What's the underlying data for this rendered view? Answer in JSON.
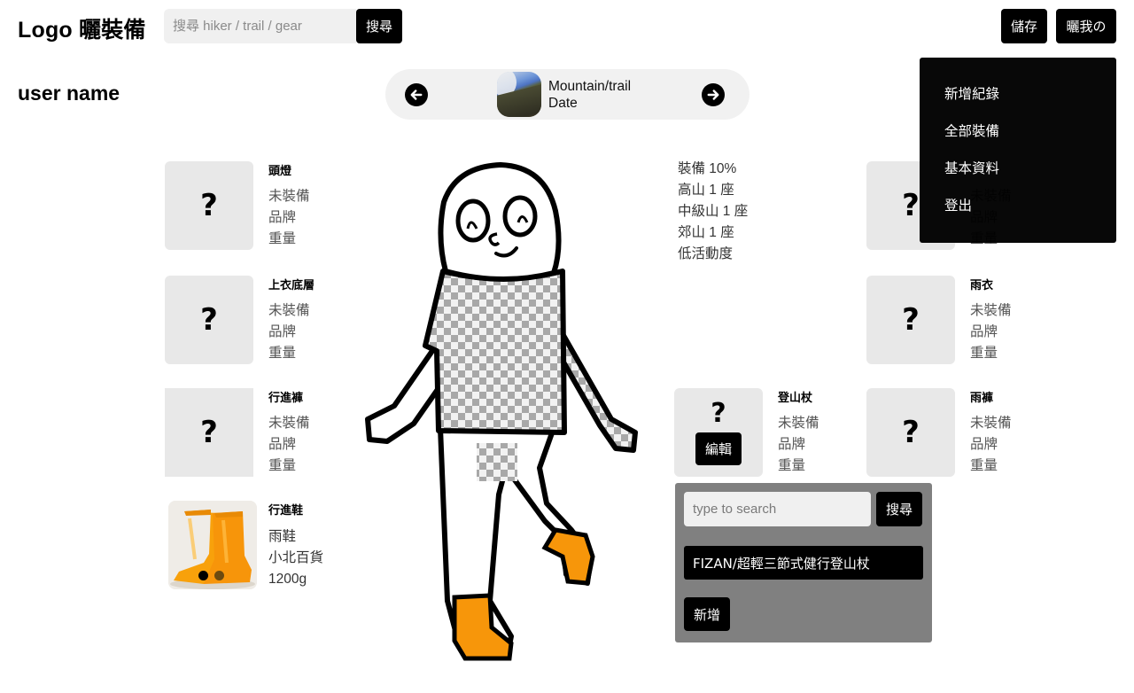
{
  "header": {
    "logo": "Logo 曬裝備",
    "search_placeholder": "搜尋 hiker / trail / gear",
    "search_button": "搜尋",
    "save_button": "儲存",
    "show_button": "曬我の"
  },
  "user": {
    "name": "user name"
  },
  "trip": {
    "title": "Mountain/trail",
    "date": "Date",
    "prev_icon": "arrow-left-circle-icon",
    "next_icon": "arrow-right-circle-icon"
  },
  "menu": {
    "items": [
      {
        "label": "新增紀錄"
      },
      {
        "label": "全部裝備"
      },
      {
        "label": "基本資料"
      },
      {
        "label": "登出"
      }
    ]
  },
  "stats": {
    "lines": [
      "裝備 10%",
      "高山 1 座",
      "中級山 1 座",
      "郊山 1 座",
      "低活動度"
    ]
  },
  "gear_left": [
    {
      "title": "頭燈",
      "status": "未裝備",
      "brand": "品牌",
      "weight": "重量"
    },
    {
      "title": "上衣底層",
      "status": "未裝備",
      "brand": "品牌",
      "weight": "重量"
    },
    {
      "title": "行進褲",
      "status": "未裝備",
      "brand": "品牌",
      "weight": "重量"
    },
    {
      "title": "行進鞋",
      "status": "雨鞋",
      "brand": "小北百貨",
      "weight": "1200g"
    }
  ],
  "gear_right": [
    {
      "title": "",
      "status": "未裝備",
      "brand": "品牌",
      "weight": "重量"
    },
    {
      "title": "雨衣",
      "status": "未裝備",
      "brand": "品牌",
      "weight": "重量"
    },
    {
      "title": "雨褲",
      "status": "未裝備",
      "brand": "品牌",
      "weight": "重量"
    }
  ],
  "gear_active": {
    "title": "登山杖",
    "status": "未裝備",
    "brand": "品牌",
    "weight": "重量",
    "edit_button": "編輯"
  },
  "picker": {
    "search_placeholder": "type to search",
    "search_button": "搜尋",
    "result": "FIZAN/超輕三節式健行登山杖",
    "add_button": "新增"
  },
  "colors": {
    "accent": "#000000",
    "card_bg": "#e8e8e8",
    "picker_bg": "#808080",
    "boot_orange": "#f7960a"
  }
}
